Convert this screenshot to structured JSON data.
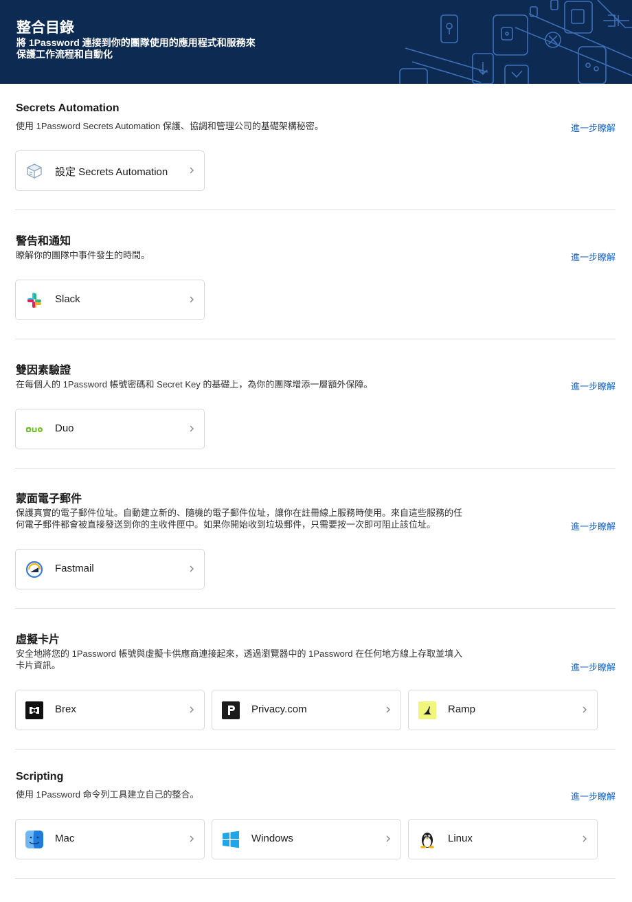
{
  "header": {
    "title": "整合目錄",
    "subtitle": "將 1Password 連接到你的團隊使用的應用程式和服務來保護工作流程和自動化"
  },
  "colors": {
    "banner": "#0d2b52",
    "link": "#1a66c9",
    "divider": "#dcdcdc"
  },
  "sections": [
    {
      "title": "Secrets Automation",
      "description": "使用 1Password Secrets Automation 保護、協調和管理公司的基礎架構秘密。",
      "learn_more": "進一步瞭解",
      "cards": [
        {
          "label": "設定 Secrets Automation",
          "icon": "secrets-automation-icon"
        }
      ]
    },
    {
      "title": "警告和通知",
      "description": "瞭解你的團隊中事件發生的時間。",
      "learn_more": "進一步瞭解",
      "cards": [
        {
          "label": "Slack",
          "icon": "slack-icon"
        }
      ]
    },
    {
      "title": "雙因素驗證",
      "description": "在每個人的 1Password 帳號密碼和 Secret Key 的基礎上，為你的團隊增添一層額外保障。",
      "learn_more": "進一步瞭解",
      "cards": [
        {
          "label": "Duo",
          "icon": "duo-icon"
        }
      ]
    },
    {
      "title": "蒙面電子郵件",
      "description": "保護真實的電子郵件位址。自動建立新的、隨機的電子郵件位址，讓你在註冊線上服務時使用。來自這些服務的任何電子郵件都會被直接發送到你的主收件匣中。如果你開始收到垃圾郵件，只需要按一次即可阻止該位址。",
      "learn_more": "進一步瞭解",
      "cards": [
        {
          "label": "Fastmail",
          "icon": "fastmail-icon"
        }
      ]
    },
    {
      "title": "虛擬卡片",
      "description": "安全地將您的 1Password 帳號與虛擬卡供應商連接起來，透過瀏覽器中的 1Password 在任何地方線上存取並填入卡片資訊。",
      "learn_more": "進一步瞭解",
      "cards": [
        {
          "label": "Brex",
          "icon": "brex-icon"
        },
        {
          "label": "Privacy.com",
          "icon": "privacy-icon"
        },
        {
          "label": "Ramp",
          "icon": "ramp-icon"
        }
      ]
    },
    {
      "title": "Scripting",
      "description": "使用 1Password 命令列工具建立自己的整合。",
      "learn_more": "進一步瞭解",
      "cards": [
        {
          "label": "Mac",
          "icon": "finder-icon"
        },
        {
          "label": "Windows",
          "icon": "windows-icon"
        },
        {
          "label": "Linux",
          "icon": "tux-icon"
        }
      ]
    }
  ]
}
